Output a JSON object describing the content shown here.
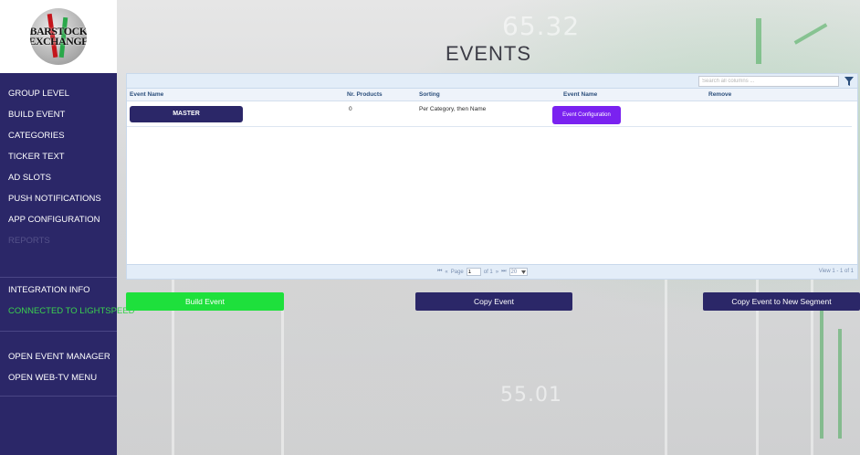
{
  "logo": {
    "line1": "BARSTOCK",
    "line2": "EXCHANGE"
  },
  "header": {
    "title": "EVENTS"
  },
  "background": {
    "ghost_top": "65.32",
    "ghost_bottom": "55.01"
  },
  "sidebar": {
    "items": [
      {
        "label": "GROUP LEVEL"
      },
      {
        "label": "BUILD EVENT"
      },
      {
        "label": "CATEGORIES"
      },
      {
        "label": "TICKER TEXT"
      },
      {
        "label": "AD SLOTS"
      },
      {
        "label": "PUSH NOTIFICATIONS"
      },
      {
        "label": "APP CONFIGURATION"
      },
      {
        "label": "REPORTS"
      }
    ],
    "integration": "INTEGRATION INFO",
    "connected": "CONNECTED TO LIGHTSPEED",
    "event_manager": "OPEN EVENT MANAGER",
    "webtv": "OPEN WEB-TV MENU"
  },
  "grid": {
    "search_placeholder": "Search all columns ...",
    "columns": [
      "Event Name",
      "Nr. Products",
      "Sorting",
      "Event Name",
      "Remove"
    ],
    "rows": [
      {
        "name": "MASTER",
        "products": "0",
        "sorting": "Per Category, then Name",
        "config": "Event Configuration"
      }
    ],
    "pager": {
      "first": "⏮",
      "prev": "«",
      "page_label": "Page",
      "page_value": "1",
      "of_label": "of 1",
      "next": "»",
      "last": "⏭",
      "page_size": "20",
      "view": "View 1 - 1 of 1"
    }
  },
  "actions": {
    "build": "Build Event",
    "copy": "Copy Event",
    "copy_segment": "Copy Event to New Segment"
  },
  "colors": {
    "sidebar_bg": "#2b2768",
    "build_btn": "#1ee03c",
    "config_btn": "#7a22f0",
    "connected_text": "#3ad14e"
  }
}
